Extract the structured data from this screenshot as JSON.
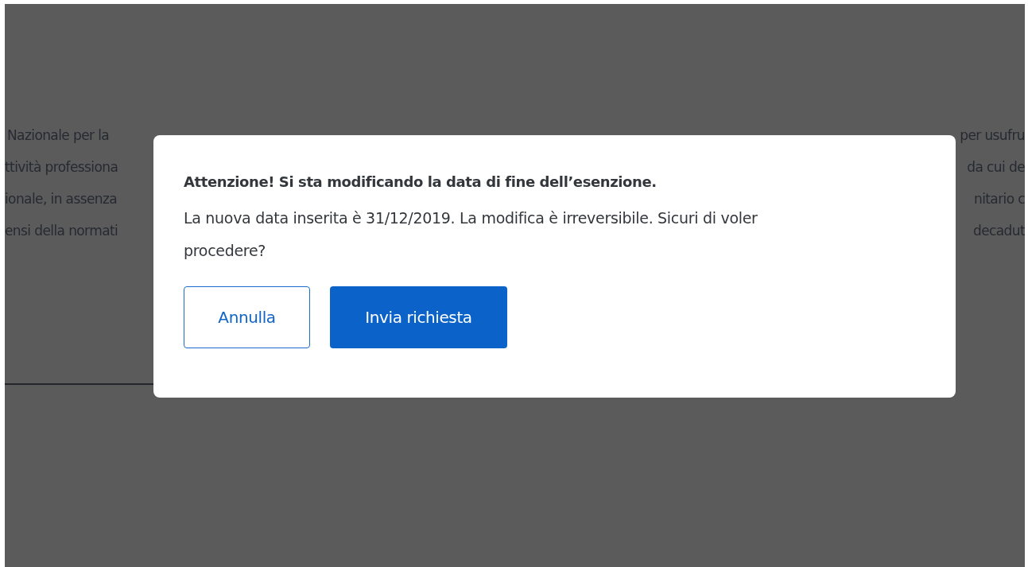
{
  "background_text": {
    "lines": [
      {
        "left": "Nazionale per la",
        "right": "per usufru"
      },
      {
        "left": "ttività professiona",
        "right": "da cui de"
      },
      {
        "left": "ionale, in assenza",
        "right": "nitario c"
      },
      {
        "left": "ensi della normati",
        "right": "decadut"
      }
    ]
  },
  "dialog": {
    "title": "Attenzione! Si sta modificando la data di fine dell’esenzione.",
    "message": "La nuova data inserita è 31/12/2019. La modifica è irreversibile. Sicuri di voler procedere?",
    "buttons": [
      {
        "label": "Annulla",
        "kind": "secondary"
      },
      {
        "label": "Invia richiesta",
        "kind": "primary"
      }
    ]
  }
}
